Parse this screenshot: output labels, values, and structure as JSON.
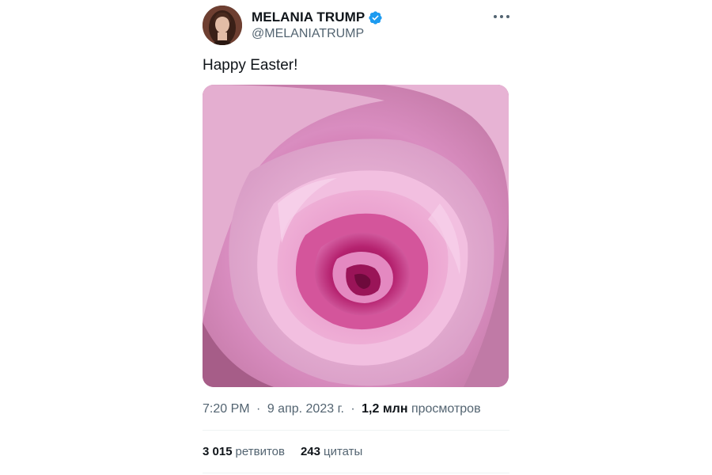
{
  "author": {
    "display_name": "MELANIA TRUMP",
    "handle": "@MELANIATRUMP",
    "verified": true,
    "verified_color": "#1d9bf0"
  },
  "icons": {
    "avatar": "avatar-photo",
    "verified": "verified-badge-icon",
    "more": "more-options-icon",
    "media": "rose-photo"
  },
  "tweet": {
    "text": "Happy Easter!",
    "media_description": "pink rose",
    "time": "7:20 PM",
    "dot": "·",
    "date": "9 апр. 2023 г.",
    "views_count": "1,2 млн",
    "views_label": "просмотров"
  },
  "stats": {
    "retweets_count": "3 015",
    "retweets_label": "ретвитов",
    "quotes_count": "243",
    "quotes_label": "цитаты"
  }
}
